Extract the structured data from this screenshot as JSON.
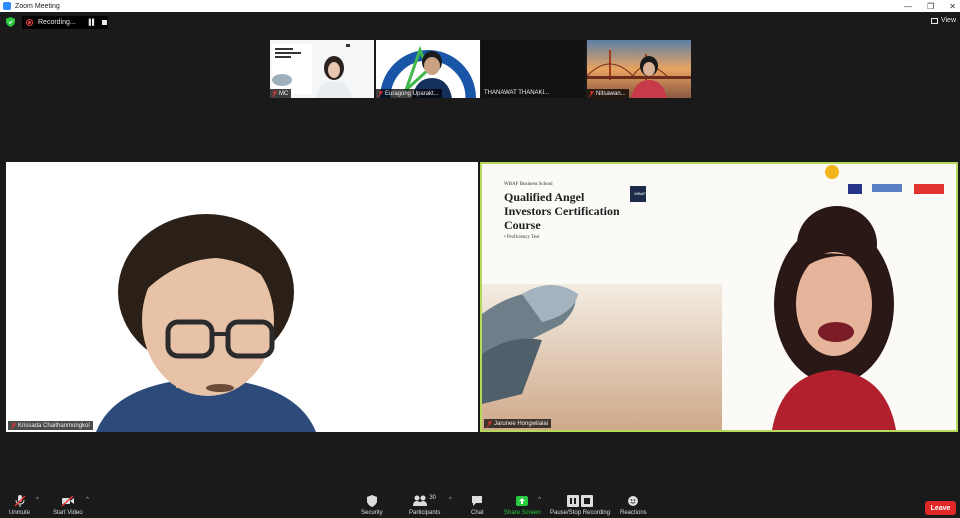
{
  "window": {
    "title": "Zoom Meeting",
    "controls": [
      "—",
      "❐",
      "✕"
    ]
  },
  "recording": {
    "label": "Recording..."
  },
  "view": {
    "label": "View"
  },
  "thumbnails": [
    {
      "name": "MC"
    },
    {
      "name": "Euragong Uparakt..."
    },
    {
      "name": "THANAWAT THANAKI..."
    },
    {
      "name": "Nitsawan..."
    }
  ],
  "main_left": {
    "name": "Krissada Chaithanmongkol"
  },
  "main_right": {
    "name": "Jarunee Hongwilalai",
    "slide": {
      "school": "WBAF Business School",
      "title_line1": "Qualified Angel",
      "title_line2": "Investors Certification",
      "title_line3": "Course",
      "sub": "• Proficiency Test",
      "logo": "WBAF"
    }
  },
  "toolbar": {
    "unmute": "Unmute",
    "start_video": "Start Video",
    "security": "Security",
    "participants": "Participants",
    "participants_count": "30",
    "chat": "Chat",
    "share_screen": "Share Screen",
    "pause_recording": "Pause/Stop Recording",
    "reactions": "Reactions",
    "leave": "Leave"
  },
  "colors": {
    "accent_green": "#27c93f",
    "active_border": "#b7d95b",
    "leave": "#e02828"
  }
}
